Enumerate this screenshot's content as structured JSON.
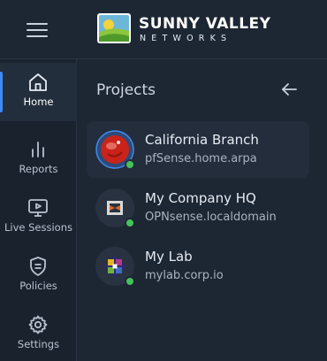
{
  "brand": {
    "name": "SUNNY VALLEY",
    "sub": "NETWORKS",
    "logo_icon": "sunny-valley-logo"
  },
  "header": {
    "menu_icon": "hamburger-menu-icon"
  },
  "sidebar": {
    "items": [
      {
        "label": "Home",
        "icon": "home-icon",
        "active": true
      },
      {
        "label": "Reports",
        "icon": "bar-chart-icon",
        "active": false
      },
      {
        "label": "Live Sessions",
        "icon": "monitor-play-icon",
        "active": false
      },
      {
        "label": "Policies",
        "icon": "shield-icon",
        "active": false
      },
      {
        "label": "Settings",
        "icon": "gear-icon",
        "active": false
      }
    ]
  },
  "projects": {
    "title": "Projects",
    "back_icon": "arrow-left-icon",
    "items": [
      {
        "name": "California Branch",
        "host": "pfSense.home.arpa",
        "status": "online",
        "logo": "pfsense-logo",
        "selected": true
      },
      {
        "name": "My Company HQ",
        "host": "OPNsense.localdomain",
        "status": "online",
        "logo": "opnsense-logo",
        "selected": false
      },
      {
        "name": "My Lab",
        "host": "mylab.corp.io",
        "status": "online",
        "logo": "lab-logo",
        "selected": false
      }
    ]
  },
  "colors": {
    "accent": "#3d8bf2",
    "online": "#45c25a",
    "background": "#1d2633"
  }
}
